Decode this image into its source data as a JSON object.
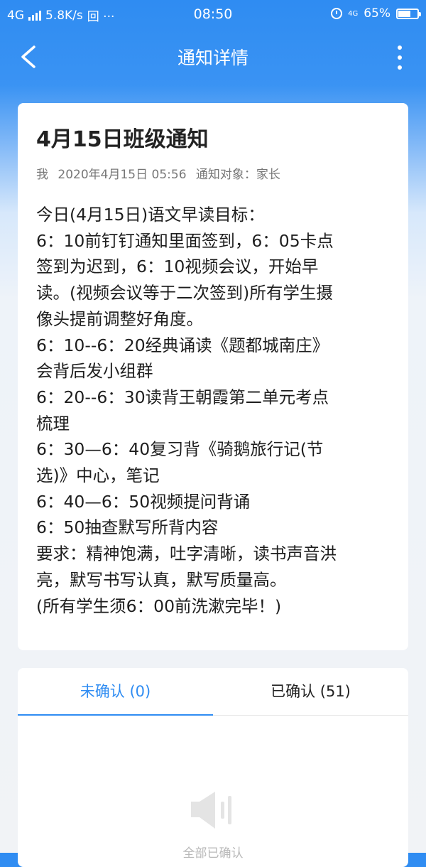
{
  "status_bar": {
    "network": "4G",
    "speed": "5.8K/s",
    "extra": "回 ···",
    "time": "08:50",
    "right_4g": "4G",
    "battery": "65%",
    "battery_level": 0.65
  },
  "app_bar": {
    "title": "通知详情"
  },
  "notice": {
    "title": "4月15日班级通知",
    "sender": "我",
    "datetime": "2020年4月15日 05:56",
    "target": "通知对象：家长",
    "body_lines": [
      "今日(4月15日)语文早读目标：",
      "6：10前钉钉通知里面签到，6：05卡点",
      "签到为迟到，6：10视频会议，开始早",
      "读。(视频会议等于二次签到)所有学生摄",
      "像头提前调整好角度。",
      "6：10--6：20经典诵读《题都城南庄》",
      "会背后发小组群",
      "6：20--6：30读背王朝霞第二单元考点",
      "梳理",
      "6：30—6：40复习背《骑鹅旅行记(节",
      "选)》中心，笔记",
      "6：40—6：50视频提问背诵",
      "6：50抽查默写所背内容",
      "要求：精神饱满，吐字清晰，读书声音洪",
      "亮，默写书写认真，默写质量高。",
      "(所有学生须6：00前洗漱完毕！)"
    ]
  },
  "confirm": {
    "tab_unconfirmed": "未确认 (0)",
    "tab_confirmed": "已确认 (51)",
    "empty_text": "全部已确认"
  },
  "colors": {
    "accent": "#2f8cf2"
  }
}
